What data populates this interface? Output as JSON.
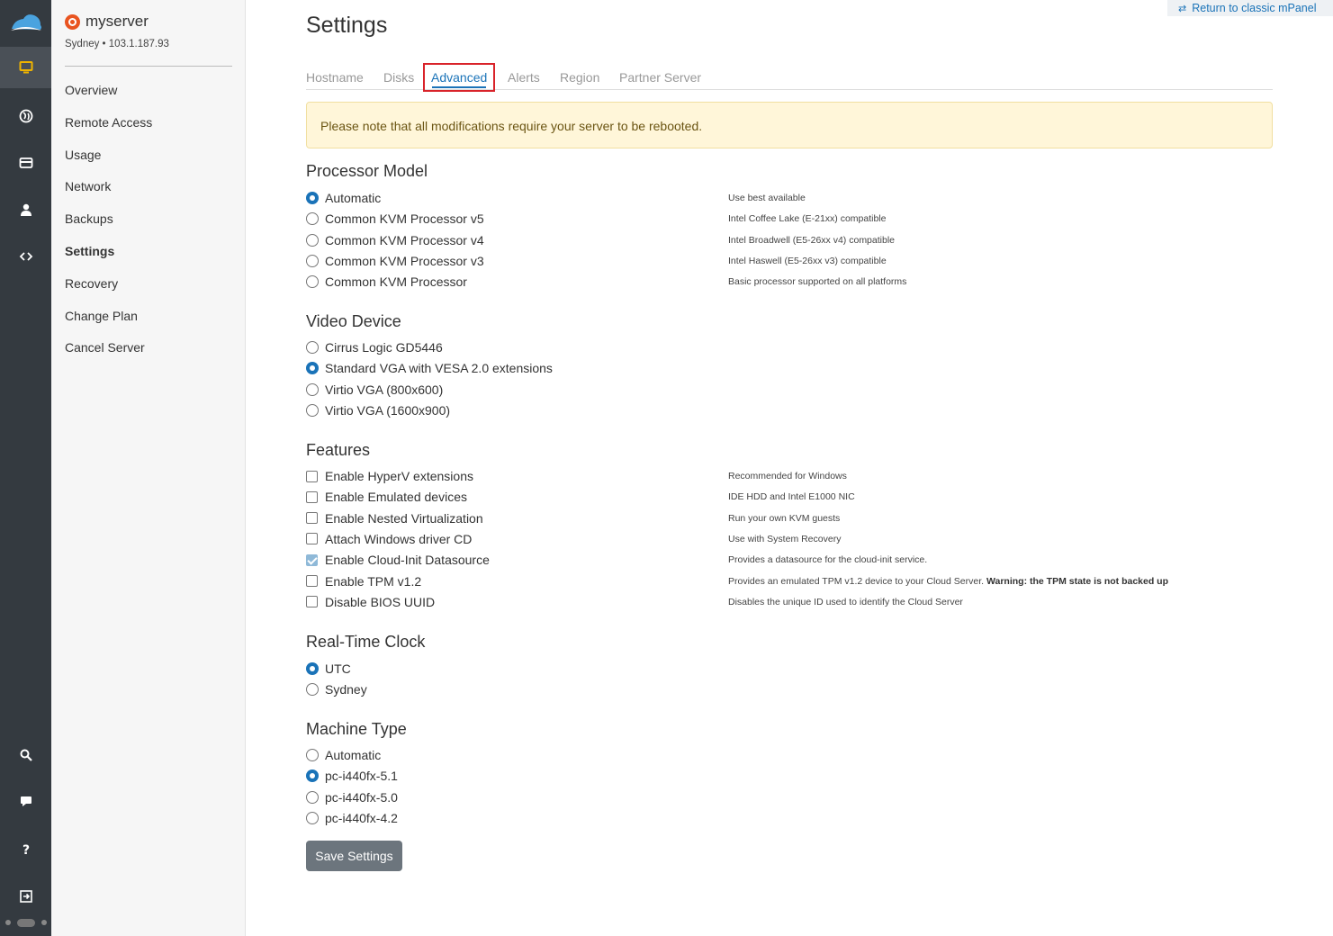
{
  "server": {
    "name": "myserver",
    "location": "Sydney • 103.1.187.93"
  },
  "sidebar": {
    "items": [
      {
        "label": "Overview"
      },
      {
        "label": "Remote Access"
      },
      {
        "label": "Usage"
      },
      {
        "label": "Network"
      },
      {
        "label": "Backups"
      },
      {
        "label": "Settings",
        "active": true
      },
      {
        "label": "Recovery"
      },
      {
        "label": "Change Plan"
      },
      {
        "label": "Cancel Server"
      }
    ]
  },
  "rail": {
    "icons": [
      "cloud-logo-icon",
      "monitor-icon",
      "globe-icon",
      "credit-card-icon",
      "user-icon",
      "code-icon",
      "search-icon",
      "chat-icon",
      "help-icon",
      "logout-icon",
      "theme-toggle"
    ],
    "active_color": "#f0b400"
  },
  "header": {
    "return_link": "Return to classic mPanel",
    "title": "Settings"
  },
  "tabs": [
    {
      "label": "Hostname"
    },
    {
      "label": "Disks"
    },
    {
      "label": "Advanced",
      "active": true
    },
    {
      "label": "Alerts"
    },
    {
      "label": "Region"
    },
    {
      "label": "Partner Server"
    }
  ],
  "alert": {
    "text": "Please note that all modifications require your server to be rebooted."
  },
  "processor": {
    "title": "Processor Model",
    "options": [
      {
        "label": "Automatic",
        "desc": "Use best available",
        "checked": true
      },
      {
        "label": "Common KVM Processor v5",
        "desc": "Intel Coffee Lake (E-21xx) compatible",
        "checked": false
      },
      {
        "label": "Common KVM Processor v4",
        "desc": "Intel Broadwell (E5-26xx v4) compatible",
        "checked": false
      },
      {
        "label": "Common KVM Processor v3",
        "desc": "Intel Haswell (E5-26xx v3) compatible",
        "checked": false
      },
      {
        "label": "Common KVM Processor",
        "desc": "Basic processor supported on all platforms",
        "checked": false
      }
    ]
  },
  "video": {
    "title": "Video Device",
    "options": [
      {
        "label": "Cirrus Logic GD5446",
        "checked": false
      },
      {
        "label": "Standard VGA with VESA 2.0 extensions",
        "checked": true
      },
      {
        "label": "Virtio VGA (800x600)",
        "checked": false
      },
      {
        "label": "Virtio VGA (1600x900)",
        "checked": false
      }
    ]
  },
  "features": {
    "title": "Features",
    "options": [
      {
        "label": "Enable HyperV extensions",
        "desc": "Recommended for Windows",
        "checked": false
      },
      {
        "label": "Enable Emulated devices",
        "desc": "IDE HDD and Intel E1000 NIC",
        "checked": false
      },
      {
        "label": "Enable Nested Virtualization",
        "desc": "Run your own KVM guests",
        "checked": false
      },
      {
        "label": "Attach Windows driver CD",
        "desc": "Use with System Recovery",
        "checked": false
      },
      {
        "label": "Enable Cloud-Init Datasource",
        "desc": "Provides a datasource for the cloud-init service.",
        "checked": true,
        "disabled": true
      },
      {
        "label": "Enable TPM v1.2",
        "desc": "Provides an emulated TPM v1.2 device to your Cloud Server.",
        "warning": "Warning: the TPM state is not backed up",
        "checked": false
      },
      {
        "label": "Disable BIOS UUID",
        "desc": "Disables the unique ID used to identify the Cloud Server",
        "checked": false
      }
    ]
  },
  "clock": {
    "title": "Real-Time Clock",
    "options": [
      {
        "label": "UTC",
        "checked": true
      },
      {
        "label": "Sydney",
        "checked": false
      }
    ]
  },
  "machine": {
    "title": "Machine Type",
    "options": [
      {
        "label": "Automatic",
        "checked": false
      },
      {
        "label": "pc-i440fx-5.1",
        "checked": true
      },
      {
        "label": "pc-i440fx-5.0",
        "checked": false
      },
      {
        "label": "pc-i440fx-4.2",
        "checked": false
      }
    ]
  },
  "save_button": "Save Settings",
  "colors": {
    "primary": "#1a73b8",
    "highlight_border": "#d9232a",
    "alert_bg": "#fff6d9",
    "rail_bg": "#343a40",
    "button_bg": "#6c757d"
  }
}
